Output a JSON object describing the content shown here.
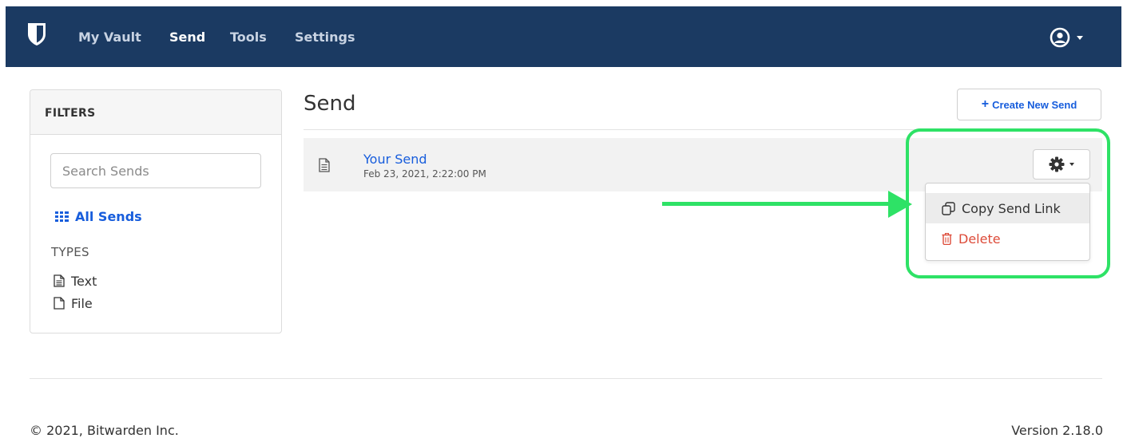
{
  "nav": {
    "links": [
      {
        "label": "My Vault",
        "active": false
      },
      {
        "label": "Send",
        "active": true
      },
      {
        "label": "Tools",
        "active": false
      },
      {
        "label": "Settings",
        "active": false
      }
    ],
    "user_icon": "user-circle-icon",
    "logo_icon": "bitwarden-shield-icon"
  },
  "filters": {
    "title": "FILTERS",
    "search_placeholder": "Search Sends",
    "all_sends_label": "All Sends",
    "all_sends_icon": "grid-icon",
    "types_label": "TYPES",
    "types": [
      {
        "label": "Text",
        "icon": "file-text-icon"
      },
      {
        "label": "File",
        "icon": "file-icon"
      }
    ]
  },
  "main": {
    "title": "Send",
    "create_button": "Create New Send",
    "sends": [
      {
        "name": "Your Send",
        "date": "Feb 23, 2021, 2:22:00 PM",
        "icon": "file-text-icon"
      }
    ],
    "options_icon": "gear-icon",
    "dropdown": [
      {
        "label": "Copy Send Link",
        "icon": "copy-icon"
      },
      {
        "label": "Delete",
        "icon": "trash-icon"
      }
    ]
  },
  "footer": {
    "copyright": "© 2021, Bitwarden Inc.",
    "version": "Version 2.18.0"
  },
  "colors": {
    "navbar": "#1b3a62",
    "link": "#175ddc",
    "danger": "#dd4b39",
    "annotation": "#2ee266"
  }
}
